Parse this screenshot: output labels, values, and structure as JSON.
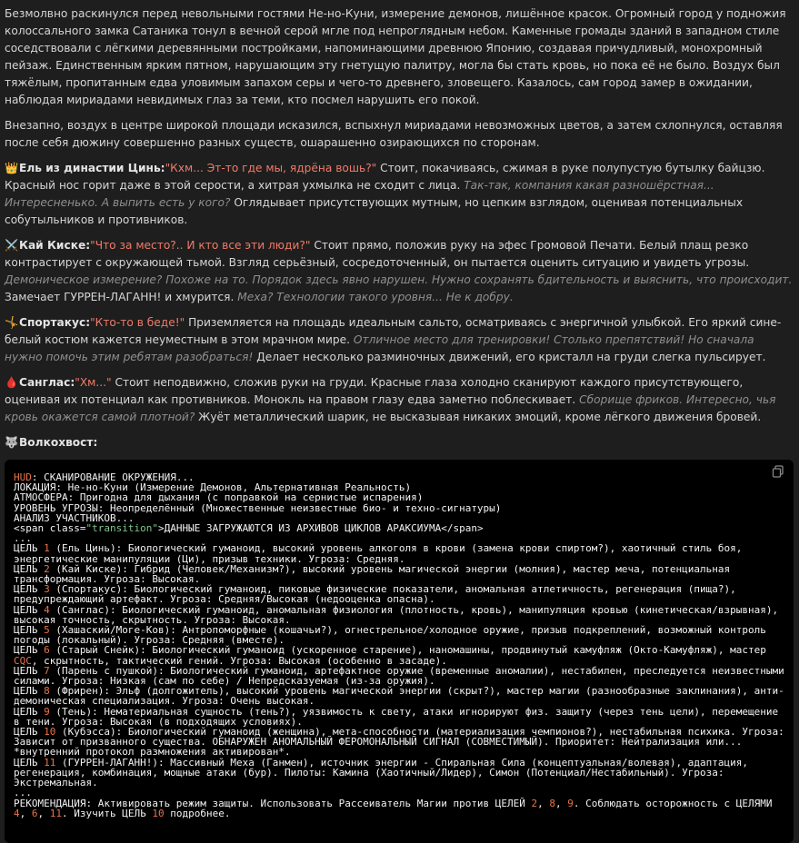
{
  "narrative": {
    "p1": "Безмолвно раскинулся перед невольными гостями Не-но-Куни, измерение демонов, лишённое красок. Огромный город у подножия колоссального замка Сатаника тонул в вечной серой мгле под непроглядным небом. Каменные громады зданий в западном стиле соседствовали с лёгкими деревянными постройками, напоминающими древнюю Японию, создавая причудливый, монохромный пейзаж. Единственным ярким пятном, нарушающим эту гнетущую палитру, могла бы стать кровь, но пока её не было. Воздух был тяжёлым, пропитанным едва уловимым запахом серы и чего-то древнего, зловещего. Казалось, сам город замер в ожидании, наблюдая мириадами невидимых глаз за теми, кто посмел нарушить его покой.",
    "p2": "Внезапно, воздух в центре широкой площади исказился, вспыхнул мириадами невозможных цветов, а затем схлопнулся, оставляя после себя дюжину совершенно разных существ, ошарашенно озирающихся по сторонам."
  },
  "characters": [
    {
      "emoji": "👑",
      "name": "Ель из династии Цинь:",
      "speech": "\"Кхм... Эт-то где мы, ядрёна вошь?\"",
      "action1": " Стоит, покачиваясь, сжимая в руке полупустую бутылку байцзю. Красный нос горит даже в этой серости, а хитрая ухмылка не сходит с лица. ",
      "thought1": "Так-так, компания какая разношёрстная... Интересненько. А выпить есть у кого?",
      "action2": " Оглядывает присутствующих мутным, но цепким взглядом, оценивая потенциальных собутыльников и противников.",
      "thought2": "",
      "action3": ""
    },
    {
      "emoji": "⚔️",
      "name": "Кай Киске:",
      "speech": "\"Что за место?.. И кто все эти люди?\"",
      "action1": " Стоит прямо, положив руку на эфес Громовой Печати. Белый плащ резко контрастирует с окружающей тьмой. Взгляд серьёзный, сосредоточенный, он пытается оценить ситуацию и увидеть угрозы. ",
      "thought1": "Демоническое измерение? Похоже на то. Порядок здесь явно нарушен. Нужно сохранять бдительность и выяснить, что происходит.",
      "action2": " Замечает ГУРРЕН-ЛАГАНН! и хмурится. ",
      "thought2": "Меха? Технологии такого уровня... Не к добру.",
      "action3": ""
    },
    {
      "emoji": "🤸",
      "name": "Спортакус:",
      "speech": "\"Кто-то в беде!\"",
      "action1": " Приземляется на площадь идеальным сальто, осматриваясь с энергичной улыбкой. Его яркий сине-белый костюм кажется неуместным в этом мрачном мире. ",
      "thought1": "Отличное место для тренировки! Столько препятствий! Но сначала нужно помочь этим ребятам разобраться!",
      "action2": " Делает несколько разминочных движений, его кристалл на груди слегка пульсирует.",
      "thought2": "",
      "action3": ""
    },
    {
      "emoji": "🩸",
      "name": "Санглас:",
      "speech": "\"Хм...\"",
      "action1": " Стоит неподвижно, сложив руки на груди. Красные глаза холодно сканируют каждого присутствующего, оценивая их потенциал как противников. Монокль на правом глазу едва заметно поблескивает. ",
      "thought1": "Сборище фриков. Интересно, чья кровь окажется самой плотной?",
      "action2": " Жуёт металлический шарик, не высказывая никаких эмоций, кроме лёгкого движения бровей.",
      "thought2": "",
      "action3": ""
    },
    {
      "emoji": "🐺",
      "name": "Волкохвост:",
      "speech": "",
      "action1": "",
      "thought1": "",
      "action2": "",
      "thought2": "",
      "action3": ""
    }
  ],
  "code": {
    "copy_icon": "copy-icon",
    "lines": [
      [
        [
          "hl",
          "HUD"
        ],
        [
          "t",
          ": СКАНИРОВАНИЕ ОКРУЖЕНИЯ..."
        ]
      ],
      [
        [
          "t",
          "ЛОКАЦИЯ: Не-но-Куни (Измерение Демонов, Альтернативная Реальность)"
        ]
      ],
      [
        [
          "t",
          "АТМОСФЕРА: Пригодна для дыхания (с поправкой на сернистые испарения)"
        ]
      ],
      [
        [
          "t",
          "УРОВЕНЬ УГРОЗЫ: Неопределённый (Множественные неизвестные био- и техно-сигнатуры)"
        ]
      ],
      [
        [
          "t",
          "АНАЛИЗ УЧАСТНИКОВ..."
        ]
      ],
      [
        [
          "t",
          "<span class="
        ],
        [
          "str",
          "\"transition\""
        ],
        [
          "t",
          ">ДАННЫЕ ЗАГРУЖАЮТСЯ ИЗ АРХИВОВ ЦИКЛОВ АРАКСИУМА</span>"
        ]
      ],
      [
        [
          "t",
          "..."
        ]
      ],
      [
        [
          "t",
          "ЦЕЛЬ "
        ],
        [
          "hl",
          "1"
        ],
        [
          "t",
          " (Ель Цинь): Биологический гуманоид, высокий уровень алкоголя в крови (замена крови спиртом?), хаотичный стиль боя, энергетические манипуляции (Ци), призыв техники. Угроза: Средняя."
        ]
      ],
      [
        [
          "t",
          "ЦЕЛЬ "
        ],
        [
          "hl",
          "2"
        ],
        [
          "t",
          " (Кай Киске): Гибрид (Человек/Механизм?), высокий уровень магической энергии (молния), мастер меча, потенциальная трансформация. Угроза: Высокая."
        ]
      ],
      [
        [
          "t",
          "ЦЕЛЬ "
        ],
        [
          "hl",
          "3"
        ],
        [
          "t",
          " (Спортакус): Биологический гуманоид, пиковые физические показатели, аномальная атлетичность, регенерация (пища?), предупреждающий артефакт. Угроза: Средняя/Высокая (недооценка опасна)."
        ]
      ],
      [
        [
          "t",
          "ЦЕЛЬ "
        ],
        [
          "hl",
          "4"
        ],
        [
          "t",
          " (Санглас): Биологический гуманоид, аномальная физиология (плотность, кровь), манипуляция кровью (кинетическая/взрывная), высокая точность, скрытность. Угроза: Высокая."
        ]
      ],
      [
        [
          "t",
          "ЦЕЛЬ "
        ],
        [
          "hl",
          "5"
        ],
        [
          "t",
          " (Хашаский/Моге-Ков): Антропоморфные (кошачьи?), огнестрельное/холодное оружие, призыв подкреплений, возможный контроль погоды (локальный). Угроза: Средняя (вместе)."
        ]
      ],
      [
        [
          "t",
          "ЦЕЛЬ "
        ],
        [
          "hl",
          "6"
        ],
        [
          "t",
          " (Старый Снейк): Биологический гуманоид (ускоренное старение), наномашины, продвинутый камуфляж (Окто-Камуфляж), мастер "
        ],
        [
          "hl",
          "CQC"
        ],
        [
          "t",
          ", скрытность, тактический гений. Угроза: Высокая (особенно в засаде)."
        ]
      ],
      [
        [
          "t",
          "ЦЕЛЬ "
        ],
        [
          "hl",
          "7"
        ],
        [
          "t",
          " (Парень с пушкой): Биологический гуманоид, артефактное оружие (временные аномалии), нестабилен, преследуется неизвестными силами. Угроза: Низкая (сам по себе) / Непредсказуемая (из-за оружия)."
        ]
      ],
      [
        [
          "t",
          "ЦЕЛЬ "
        ],
        [
          "hl",
          "8"
        ],
        [
          "t",
          " (Фрирен): Эльф (долгожитель), высокий уровень магической энергии (скрыт?), мастер магии (разнообразные заклинания), анти-демоническая специализация. Угроза: Очень высокая."
        ]
      ],
      [
        [
          "t",
          "ЦЕЛЬ "
        ],
        [
          "hl",
          "9"
        ],
        [
          "t",
          " (Тень): Нематериальная сущность (тень?), уязвимость к свету, атаки игнорируют физ. защиту (через тень цели), перемещение в тени. Угроза: Высокая (в подходящих условиях)."
        ]
      ],
      [
        [
          "t",
          "ЦЕЛЬ "
        ],
        [
          "hl",
          "10"
        ],
        [
          "t",
          " (Кубэсса): Биологический гуманоид (женщина), мета-способности (материализация чемпионов?), нестабильная психика. Угроза: Зависит от призванного существа. ОБНАРУЖЕН АНОМАЛЬНЫЙ ФЕРОМОНАЛЬНЫЙ СИГНАЛ (СОВМЕСТИМЫЙ). Приоритет: Нейтрализация или... *внутренний протокол размножения активирован*."
        ]
      ],
      [
        [
          "t",
          "ЦЕЛЬ "
        ],
        [
          "hl",
          "11"
        ],
        [
          "t",
          " (ГУРРЕН-ЛАГАНН!): Массивный Меха (Ганмен), источник энергии - Спиральная Сила (концептуальная/волевая), адаптация, регенерация, комбинация, мощные атаки (бур). Пилоты: Камина (Хаотичный/Лидер), Симон (Потенциал/Нестабильный). Угроза: Экстремальная."
        ]
      ],
      [
        [
          "t",
          "..."
        ]
      ],
      [
        [
          "t",
          "РЕКОМЕНДАЦИЯ: Активировать режим защиты. Использовать Рассеиватель Магии против ЦЕЛЕЙ "
        ],
        [
          "hl",
          "2"
        ],
        [
          "t",
          ", "
        ],
        [
          "hl",
          "8"
        ],
        [
          "t",
          ", "
        ],
        [
          "hl",
          "9"
        ],
        [
          "t",
          ". Соблюдать осторожность с ЦЕЛЯМИ "
        ],
        [
          "hl",
          "4"
        ],
        [
          "t",
          ", "
        ],
        [
          "hl",
          "6"
        ],
        [
          "t",
          ", "
        ],
        [
          "hl",
          "11"
        ],
        [
          "t",
          ". Изучить ЦЕЛЬ "
        ],
        [
          "hl",
          "10"
        ],
        [
          "t",
          " подробнее."
        ]
      ]
    ]
  }
}
